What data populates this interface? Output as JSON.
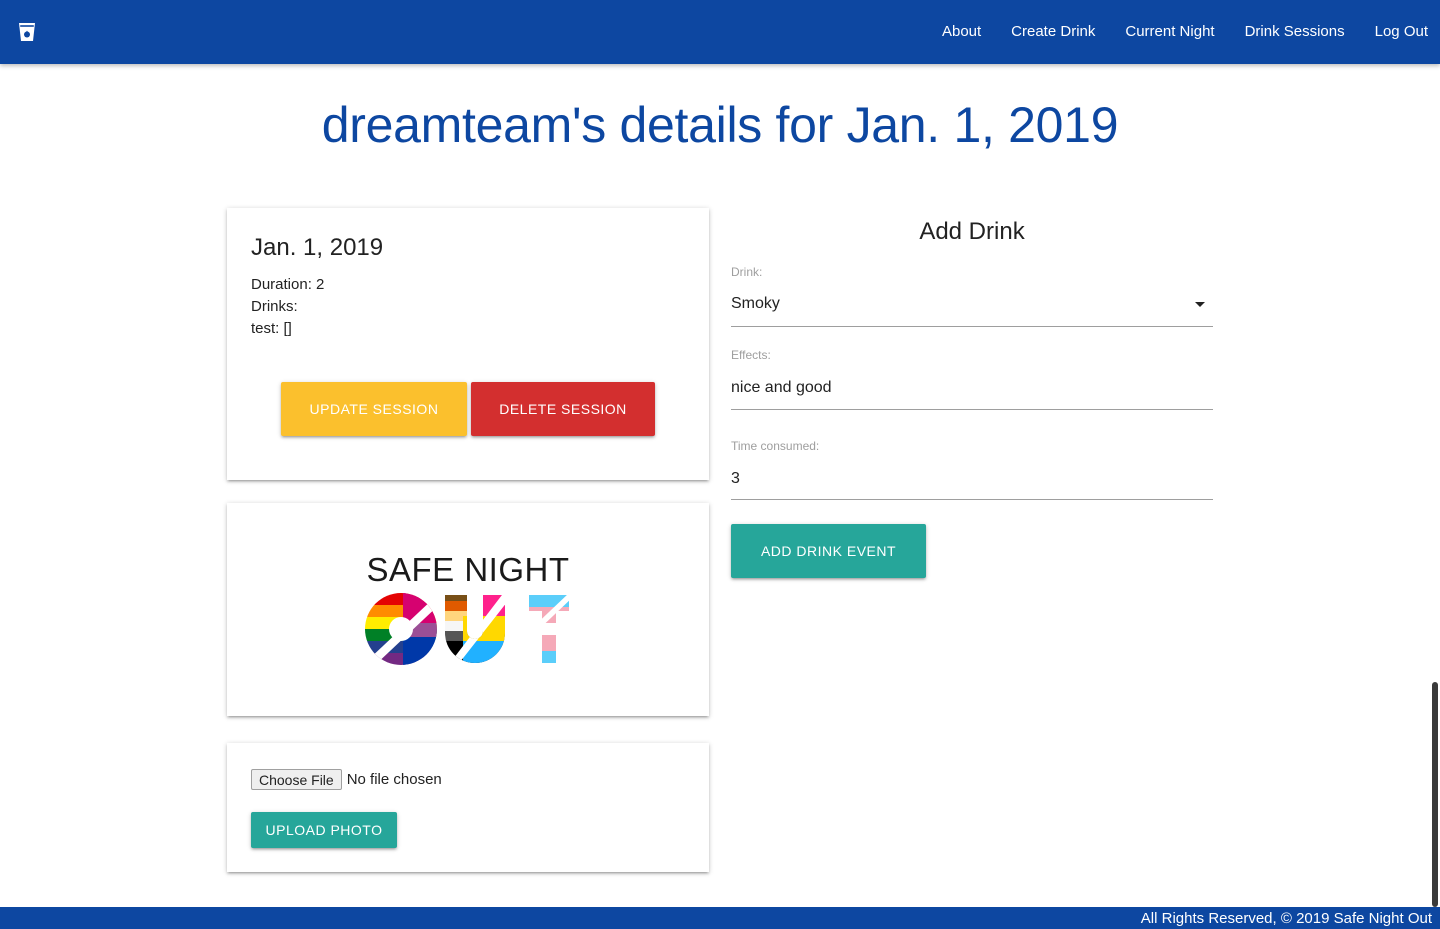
{
  "nav": {
    "links": [
      "About",
      "Create Drink",
      "Current Night",
      "Drink Sessions",
      "Log Out"
    ],
    "logo_icon": "cup-icon"
  },
  "page": {
    "title": "dreamteam's details for Jan. 1, 2019"
  },
  "session": {
    "date": "Jan. 1, 2019",
    "duration": "Duration: 2",
    "drinks": "Drinks:",
    "test": "test: []",
    "update_label": "UPDATE SESSION",
    "delete_label": "DELETE SESSION"
  },
  "logo": {
    "title": "SAFE NIGHT",
    "subtitle": "OUT"
  },
  "upload": {
    "choose_label": "Choose File",
    "status": "No file chosen",
    "upload_label": "UPLOAD PHOTO"
  },
  "add_drink": {
    "title": "Add Drink",
    "drink_label": "Drink:",
    "drink_value": "Smoky",
    "effects_label": "Effects:",
    "effects_value": "nice and good",
    "time_label": "Time consumed:",
    "time_value": "3",
    "add_label": "ADD DRINK EVENT"
  },
  "footer": {
    "text": "All Rights Reserved, © 2019 Safe Night Out"
  },
  "colors": {
    "primary": "#0d47a1",
    "update": "#fbc02d",
    "delete": "#d32f2f",
    "teal": "#26a69a"
  }
}
